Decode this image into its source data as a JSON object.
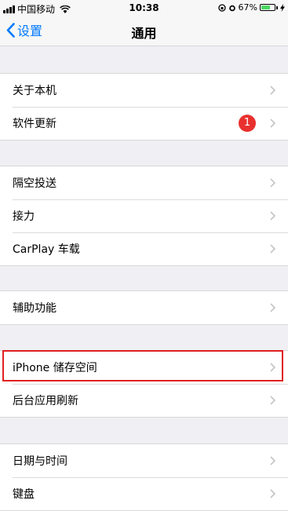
{
  "status_bar": {
    "carrier": "中国移动",
    "time": "10:38",
    "battery_percent": "67%",
    "battery_level": 0.67
  },
  "nav": {
    "back_label": "设置",
    "title": "通用"
  },
  "groups": {
    "g1": {
      "about": "关于本机",
      "software_update": "软件更新",
      "update_badge": "1"
    },
    "g2": {
      "airdrop": "隔空投送",
      "handoff": "接力",
      "carplay": "CarPlay 车载"
    },
    "g3": {
      "accessibility": "辅助功能"
    },
    "g4": {
      "iphone_storage": "iPhone 储存空间",
      "background_refresh": "后台应用刷新"
    },
    "g5": {
      "date_time": "日期与时间",
      "keyboard": "键盘"
    }
  },
  "colors": {
    "accent": "#007aff",
    "badge": "#e8312f",
    "highlight": "#e02020",
    "battery": "#4cd964"
  }
}
